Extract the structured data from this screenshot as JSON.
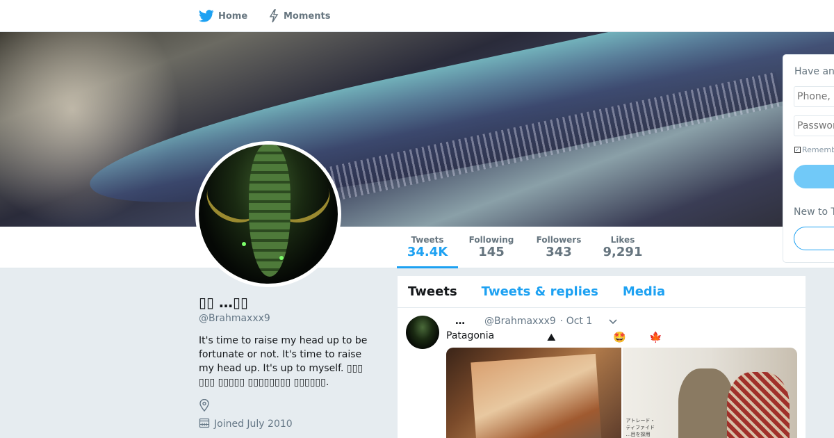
{
  "nav": {
    "home_label": "Home",
    "moments_label": "Moments"
  },
  "stats": [
    {
      "label": "Tweets",
      "value": "34.4K",
      "active": true
    },
    {
      "label": "Following",
      "value": "145",
      "active": false
    },
    {
      "label": "Followers",
      "value": "343",
      "active": false
    },
    {
      "label": "Likes",
      "value": "9,291",
      "active": false
    }
  ],
  "profile": {
    "name": "▯▯ …▯▯",
    "handle": "@Brahmaxxx9",
    "bio": "It's time to raise my head up to be fortunate or not. It's time to raise my head up. It's up to myself. ▯▯▯ ▯▯▯ ▯▯▯▯▯ ▯▯▯▯▯▯▯▯ ▯▯▯▯▯▯.",
    "joined": "Joined July 2010"
  },
  "timeline": {
    "tabs": [
      "Tweets",
      "Tweets & replies",
      "Media"
    ],
    "tweet": {
      "name": "…",
      "handle": "@Brahmaxxx9",
      "date": "· Oct 1",
      "text": "Patagonia",
      "emojis": [
        "⛰",
        "🤩",
        "🍁"
      ],
      "media_caption_jp": [
        "アトレード・",
        "ティファイド",
        "…目を採用"
      ]
    }
  },
  "login": {
    "title": "Have an",
    "phone_placeholder": "Phone,",
    "password_placeholder": "Passwor",
    "remember_label": "Rememb",
    "new_label": "New to T"
  },
  "colors": {
    "accent": "#1da1f2",
    "background": "#e6ecf0"
  }
}
